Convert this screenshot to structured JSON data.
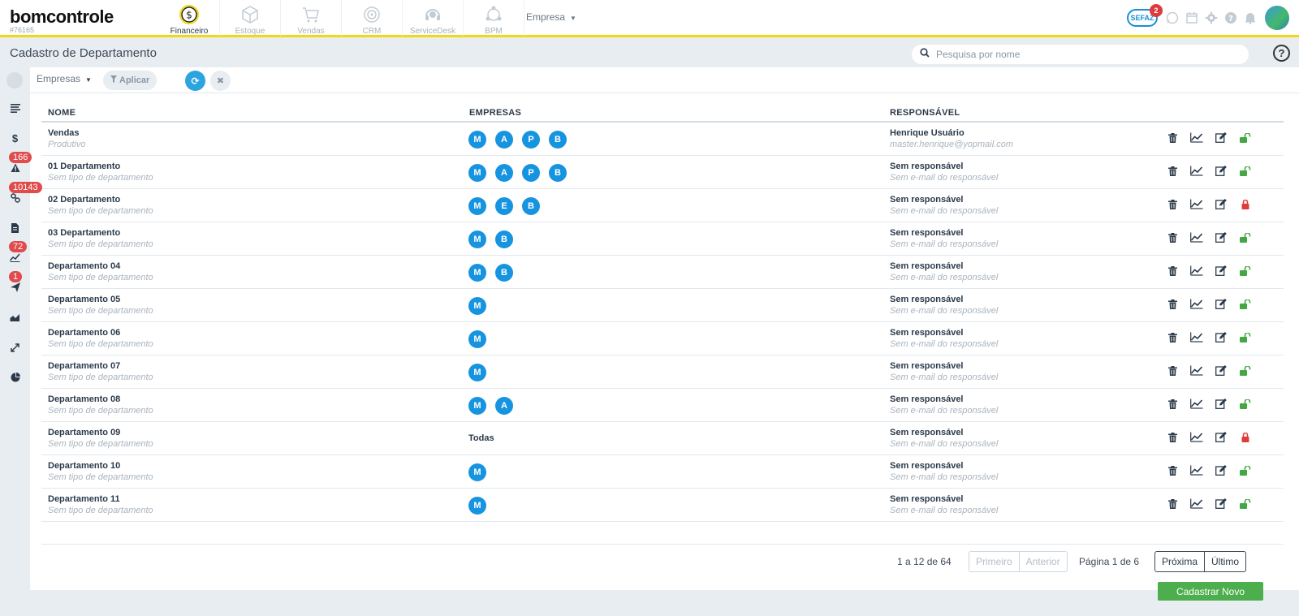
{
  "app": {
    "logo": "bomcontrole",
    "account_id": "#76165"
  },
  "modules": [
    {
      "label": "Financeiro",
      "icon": "dollar-coin-icon",
      "active": true
    },
    {
      "label": "Estoque",
      "icon": "box-icon",
      "active": false
    },
    {
      "label": "Vendas",
      "icon": "cart-icon",
      "active": false
    },
    {
      "label": "CRM",
      "icon": "target-icon",
      "active": false
    },
    {
      "label": "ServiceDesk",
      "icon": "headset-icon",
      "active": false
    },
    {
      "label": "BPM",
      "icon": "flow-icon",
      "active": false
    }
  ],
  "company_menu": {
    "label": "Empresa"
  },
  "topright": {
    "sefaz_label": "SEFAZ",
    "sefaz_badge": "2"
  },
  "page": {
    "title": "Cadastro de Departamento",
    "search_placeholder": "Pesquisa por nome",
    "help": "?"
  },
  "sidebar": {
    "badges": [
      "166",
      "10143",
      "72",
      "1"
    ]
  },
  "filters": {
    "empresas_label": "Empresas",
    "apply_label": "Aplicar"
  },
  "table": {
    "headers": {
      "name": "NOME",
      "empresas": "EMPRESAS",
      "responsavel": "RESPONSÁVEL"
    },
    "rows": [
      {
        "name": "Vendas",
        "type": "Produtivo",
        "empresas": [
          "M",
          "A",
          "P",
          "B"
        ],
        "resp": "Henrique Usuário",
        "email": "master.henrique@yopmail.com",
        "locked": false
      },
      {
        "name": "01 Departamento",
        "type": "Sem tipo de departamento",
        "empresas": [
          "M",
          "A",
          "P",
          "B"
        ],
        "resp": "Sem responsável",
        "email": "Sem e-mail do responsável",
        "locked": false
      },
      {
        "name": "02 Departamento",
        "type": "Sem tipo de departamento",
        "empresas": [
          "M",
          "E",
          "B"
        ],
        "resp": "Sem responsável",
        "email": "Sem e-mail do responsável",
        "locked": true
      },
      {
        "name": "03 Departamento",
        "type": "Sem tipo de departamento",
        "empresas": [
          "M",
          "B"
        ],
        "resp": "Sem responsável",
        "email": "Sem e-mail do responsável",
        "locked": false
      },
      {
        "name": "Departamento 04",
        "type": "Sem tipo de departamento",
        "empresas": [
          "M",
          "B"
        ],
        "resp": "Sem responsável",
        "email": "Sem e-mail do responsável",
        "locked": false
      },
      {
        "name": "Departamento 05",
        "type": "Sem tipo de departamento",
        "empresas": [
          "M"
        ],
        "resp": "Sem responsável",
        "email": "Sem e-mail do responsável",
        "locked": false
      },
      {
        "name": "Departamento 06",
        "type": "Sem tipo de departamento",
        "empresas": [
          "M"
        ],
        "resp": "Sem responsável",
        "email": "Sem e-mail do responsável",
        "locked": false
      },
      {
        "name": "Departamento 07",
        "type": "Sem tipo de departamento",
        "empresas": [
          "M"
        ],
        "resp": "Sem responsável",
        "email": "Sem e-mail do responsável",
        "locked": false
      },
      {
        "name": "Departamento 08",
        "type": "Sem tipo de departamento",
        "empresas": [
          "M",
          "A"
        ],
        "resp": "Sem responsável",
        "email": "Sem e-mail do responsável",
        "locked": false
      },
      {
        "name": "Departamento 09",
        "type": "Sem tipo de departamento",
        "empresas_text": "Todas",
        "empresas": [],
        "resp": "Sem responsável",
        "email": "Sem e-mail do responsável",
        "locked": true
      },
      {
        "name": "Departamento 10",
        "type": "Sem tipo de departamento",
        "empresas": [
          "M"
        ],
        "resp": "Sem responsável",
        "email": "Sem e-mail do responsável",
        "locked": false
      },
      {
        "name": "Departamento 11",
        "type": "Sem tipo de departamento",
        "empresas": [
          "M"
        ],
        "resp": "Sem responsável",
        "email": "Sem e-mail do responsável",
        "locked": false
      }
    ]
  },
  "pagination": {
    "count": "1 a 12 de 64",
    "first": "Primeiro",
    "prev": "Anterior",
    "page_info": "Página 1 de 6",
    "next": "Próxima",
    "last": "Último"
  },
  "actions": {
    "new_label": "Cadastrar Novo"
  },
  "colors": {
    "accent": "#2ba4e0",
    "chip": "#1694e0",
    "success": "#4cae4c",
    "unlocked": "#43a843",
    "locked": "#e03b3b",
    "top_border": "#f2d90f"
  }
}
